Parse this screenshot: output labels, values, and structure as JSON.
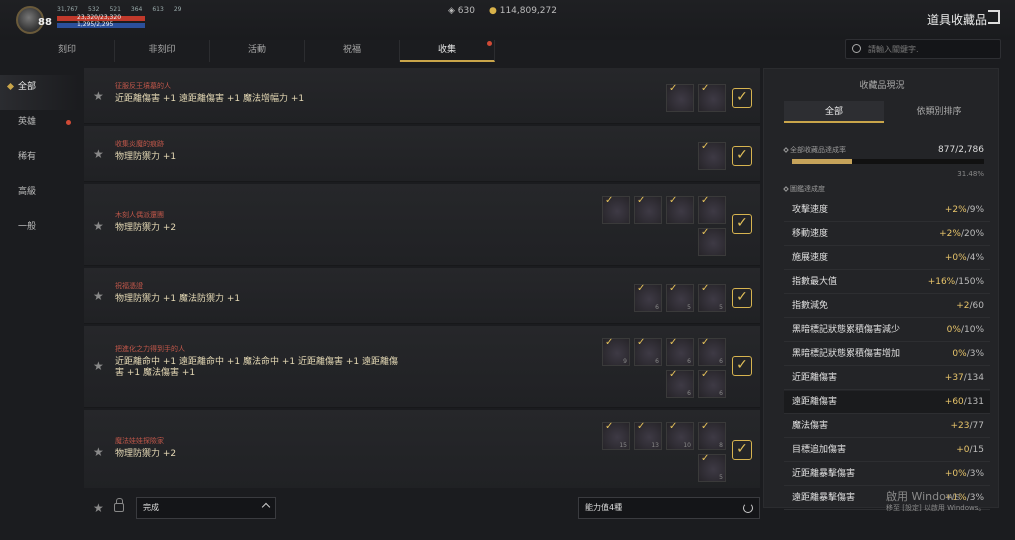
{
  "player": {
    "level": "88",
    "stats": [
      "31,767",
      "532",
      "521",
      "364",
      "613",
      "29"
    ],
    "hp": "23,320/23,320",
    "mp": "1,295/2,295"
  },
  "currency": {
    "gems": "630",
    "gold": "114,809,272"
  },
  "title": "道具收藏品",
  "tabs": [
    "刻印",
    "非刻印",
    "活動",
    "祝福",
    "收集"
  ],
  "search": {
    "placeholder": "請輸入關鍵字."
  },
  "sidebar": [
    "全部",
    "英雄",
    "稀有",
    "高級",
    "一般"
  ],
  "rows": [
    {
      "title": "征服反王墳墓的人",
      "effect": "近距離傷害 +1 遠距離傷害 +1 魔法增幅力 +1",
      "slots": [
        "",
        ""
      ]
    },
    {
      "title": "收集炎魔的痕跡",
      "effect": "物理防禦力 +1",
      "slots": [
        ""
      ]
    },
    {
      "title": "木刻人偶派還團",
      "effect": "物理防禦力 +2",
      "slots": [
        "",
        "",
        "",
        "",
        ""
      ]
    },
    {
      "title": "祝福憑證",
      "effect": "物理防禦力 +1 魔法防禦力 +1",
      "slots": [
        "6",
        "5",
        "5"
      ]
    },
    {
      "title": "把進化之力得到手的人",
      "effect": "近距離命中 +1 遠距離命中 +1 魔法命中 +1 近距離傷害 +1 遠距離傷害 +1 魔法傷害 +1",
      "slots": [
        "9",
        "6",
        "6",
        "6",
        "6",
        "6"
      ]
    },
    {
      "title": "魔法娃娃探險家",
      "effect": "物理防禦力 +2",
      "slots": [
        "15",
        "13",
        "10",
        "8",
        "5"
      ]
    }
  ],
  "bottom": {
    "filter": "完成",
    "ability": "能力值4種"
  },
  "panel": {
    "title": "收藏品現況",
    "tab_all": "全部",
    "tab_cat": "依類別排序",
    "total_label": "全部收藏品達成率",
    "total_value": "877/2,786",
    "total_pct": "31.48%",
    "total_fraction": 0.3148,
    "sub_label": "圖鑑達成度",
    "stats": [
      {
        "name": "攻擊速度",
        "cur": "+2%",
        "max": "/9%"
      },
      {
        "name": "移動速度",
        "cur": "+2%",
        "max": "/20%"
      },
      {
        "name": "施展速度",
        "cur": "+0%",
        "max": "/4%"
      },
      {
        "name": "指數最大值",
        "cur": "+16%",
        "max": "/150%"
      },
      {
        "name": "指數減免",
        "cur": "+2",
        "max": "/60"
      },
      {
        "name": "黑暗標記狀態累積傷害減少",
        "cur": "0%",
        "max": "/10%"
      },
      {
        "name": "黑暗標記狀態累積傷害增加",
        "cur": "0%",
        "max": "/3%"
      },
      {
        "name": "近距離傷害",
        "cur": "+37",
        "max": "/134"
      },
      {
        "name": "遠距離傷害",
        "cur": "+60",
        "max": "/131"
      },
      {
        "name": "魔法傷害",
        "cur": "+23",
        "max": "/77"
      },
      {
        "name": "目標追加傷害",
        "cur": "+0",
        "max": "/15"
      },
      {
        "name": "近距離暴擊傷害",
        "cur": "+0%",
        "max": "/3%"
      },
      {
        "name": "遠距離暴擊傷害",
        "cur": "+1%",
        "max": "/3%"
      }
    ]
  },
  "watermark": {
    "line1": "啟用 Windows",
    "line2": "移至 [設定] 以啟用 Windows。"
  }
}
